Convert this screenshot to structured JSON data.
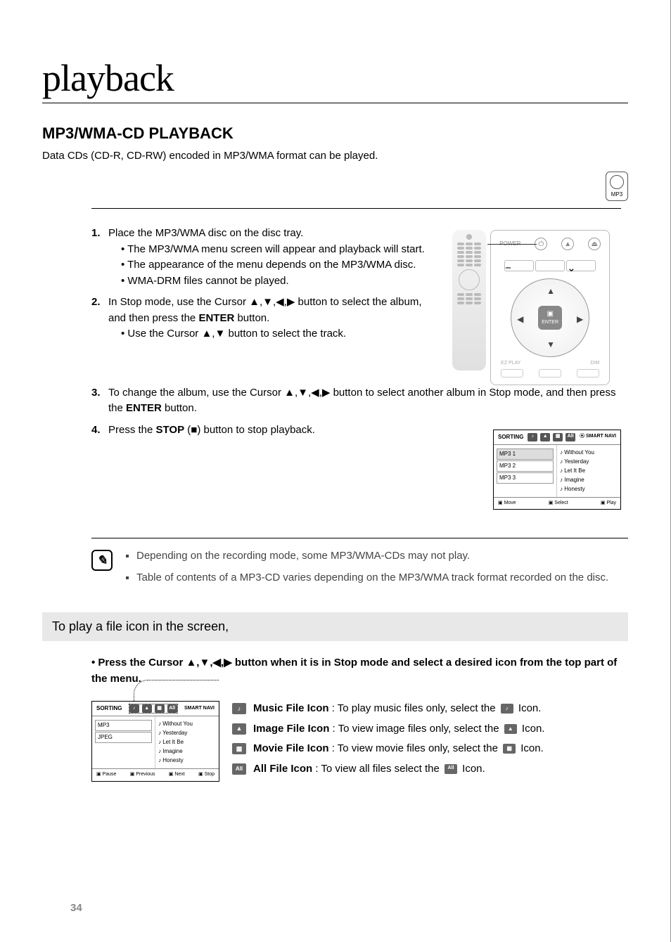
{
  "title": "playback",
  "section_heading": "MP3/WMA-CD PLAYBACK",
  "intro": "Data CDs (CD-R, CD-RW) encoded in MP3/WMA format can be played.",
  "mp3_badge": "MP3",
  "steps": {
    "s1": {
      "num": "1.",
      "text": "Place the MP3/WMA disc on the disc tray.",
      "subs": [
        "• The MP3/WMA menu screen will appear and playback will start.",
        "• The appearance of the menu depends on the MP3/WMA disc.",
        "• WMA-DRM files cannot be played."
      ]
    },
    "s2": {
      "num": "2.",
      "text_a": "In Stop mode, use the Cursor ▲,▼,◀,▶ button to select the album, and then press the ",
      "text_b": "ENTER",
      "text_c": " button.",
      "subs": [
        "• Use the Cursor ▲,▼ button to select the track."
      ]
    },
    "s3": {
      "num": "3.",
      "text_a": "To change the album, use the Cursor ▲,▼,◀,▶ button to select another album in Stop mode, and then press the ",
      "text_b": "ENTER",
      "text_c": " button."
    },
    "s4": {
      "num": "4.",
      "text_a": "Press the ",
      "text_b": "STOP",
      "text_c": " (■) button to stop playback."
    }
  },
  "remote": {
    "power": "POWER",
    "enter": "ENTER",
    "bottom_labels": [
      "EZ PLAY",
      "",
      "DIM"
    ]
  },
  "osd1": {
    "sorting": "SORTING",
    "smart": "SMART NAVI",
    "folders": [
      "MP3 1",
      "MP3 2",
      "MP3 3"
    ],
    "tracks": [
      "Without You",
      "Yesterday",
      "Let It Be",
      "Imagine",
      "Honesty"
    ],
    "bot": [
      "Move",
      "Select",
      "Play"
    ]
  },
  "notes": [
    "Depending on the recording mode, some MP3/WMA-CDs may not play.",
    "Table of contents of a MP3-CD varies depending on the MP3/WMA track format recorded on the disc."
  ],
  "graybar": "To play a file icon in the screen,",
  "file_lead": "• Press the Cursor ▲,▼,◀,▶ button when it is in Stop mode and select a desired icon from the top part of the menu.",
  "osd2": {
    "sorting": "SORTING",
    "smart": "SMART NAVI",
    "folders": [
      "MP3",
      "JPEG"
    ],
    "tracks": [
      "Without You",
      "Yesterday",
      "Let It Be",
      "Imagine",
      "Honesty"
    ],
    "bot": [
      "Pause",
      "Previous",
      "Next",
      "Stop"
    ]
  },
  "icons": {
    "music": {
      "glyph": "♪",
      "name": "Music File Icon",
      "desc_a": " : To play music files only, select the ",
      "desc_b": " Icon."
    },
    "image": {
      "glyph": "▲",
      "name": "Image File Icon",
      "desc_a": " : To view image files only, select the ",
      "desc_b": " Icon."
    },
    "movie": {
      "glyph": "▦",
      "name": "Movie File Icon",
      "desc_a": " : To view movie files only, select the ",
      "desc_b": " Icon."
    },
    "all": {
      "glyph": "All",
      "name": "All File Icon",
      "desc_a": " : To view all files select the ",
      "desc_b": " Icon."
    }
  },
  "page_number": "34"
}
